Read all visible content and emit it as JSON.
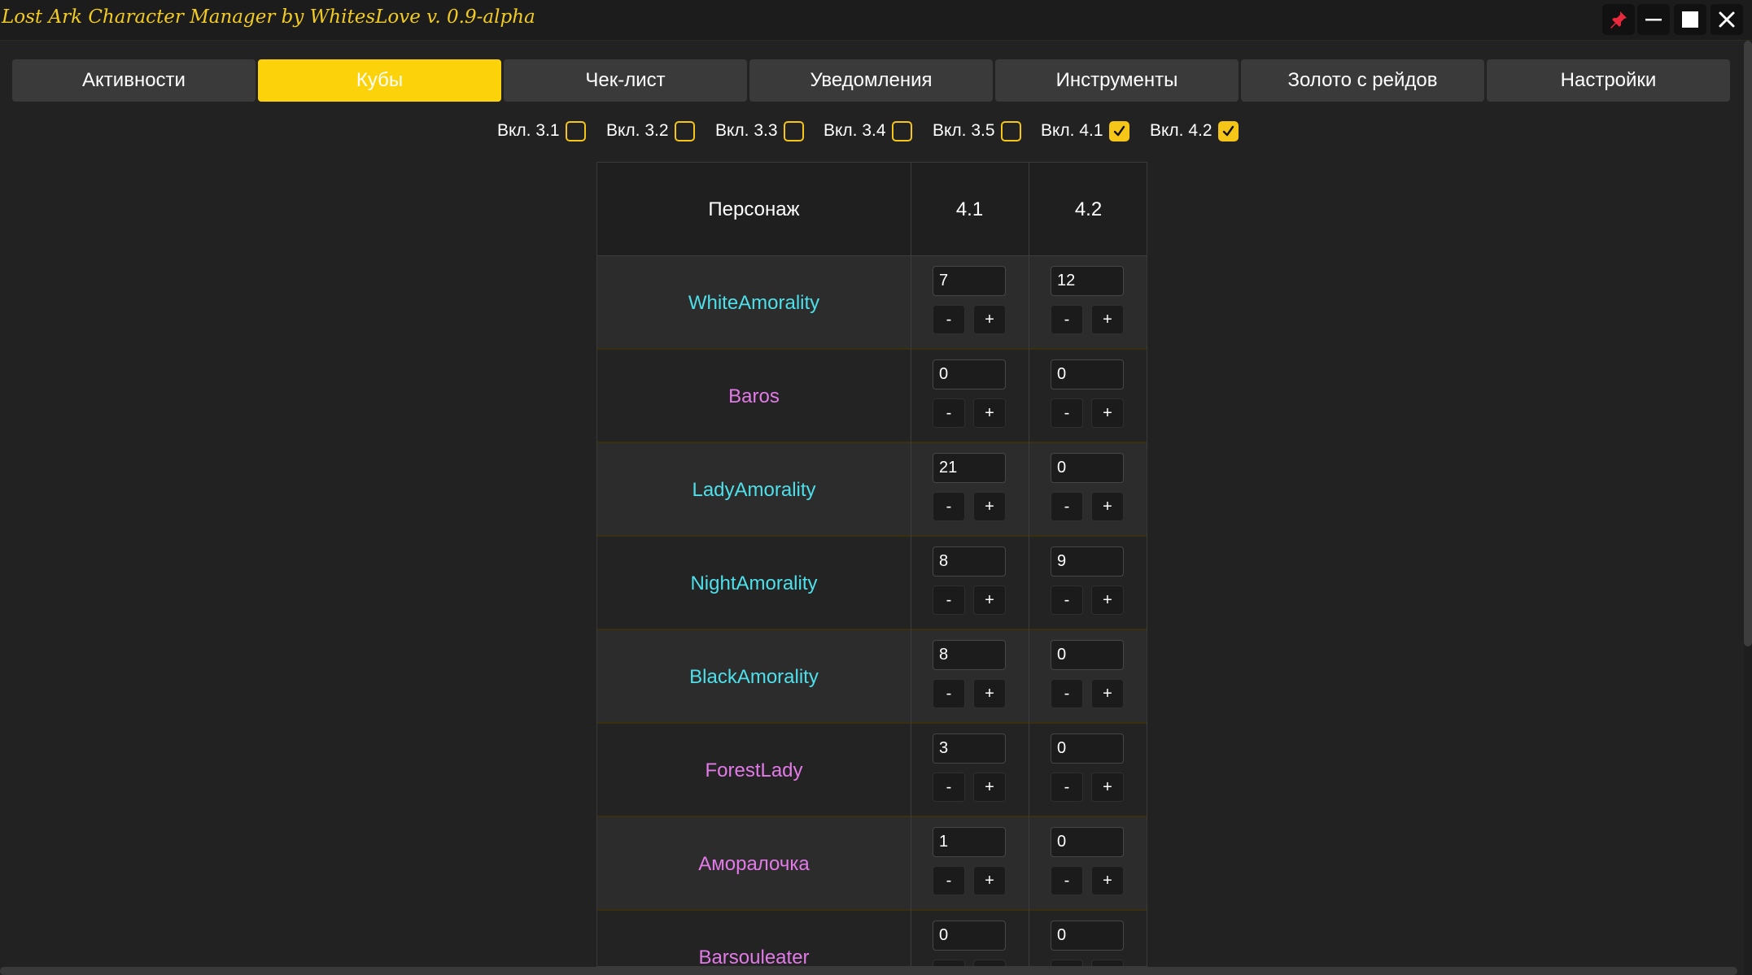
{
  "window": {
    "title": "Lost Ark Character Manager by WhitesLove v. 0.9-alpha",
    "controls": [
      "pin-icon",
      "minimize-icon",
      "maximize-icon",
      "close-icon"
    ],
    "title_color": "#f3cc22"
  },
  "tabs": [
    {
      "label": "Активности",
      "active": false
    },
    {
      "label": "Кубы",
      "active": true
    },
    {
      "label": "Чек-лист",
      "active": false
    },
    {
      "label": "Уведомления",
      "active": false
    },
    {
      "label": "Инструменты",
      "active": false
    },
    {
      "label": "Золото с рейдов",
      "active": false
    },
    {
      "label": "Настройки",
      "active": false
    }
  ],
  "accent_color": "#fcd20a",
  "filters": [
    {
      "label": "Вкл. 3.1",
      "checked": false
    },
    {
      "label": "Вкл. 3.2",
      "checked": false
    },
    {
      "label": "Вкл. 3.3",
      "checked": false
    },
    {
      "label": "Вкл. 3.4",
      "checked": false
    },
    {
      "label": "Вкл. 3.5",
      "checked": false
    },
    {
      "label": "Вкл. 4.1",
      "checked": true
    },
    {
      "label": "Вкл. 4.2",
      "checked": true
    }
  ],
  "table": {
    "headers": [
      "Персонаж",
      "4.1",
      "4.2"
    ],
    "decrement_label": "-",
    "increment_label": "+",
    "rows": [
      {
        "name": "WhiteAmorality",
        "color": "#4ee0ea",
        "values": [
          "7",
          "12"
        ]
      },
      {
        "name": "Baros",
        "color": "#e27ae8",
        "values": [
          "0",
          "0"
        ]
      },
      {
        "name": "LadyAmorality",
        "color": "#4ee0ea",
        "values": [
          "21",
          "0"
        ]
      },
      {
        "name": "NightAmorality",
        "color": "#4ee0ea",
        "values": [
          "8",
          "9"
        ]
      },
      {
        "name": "BlackAmorality",
        "color": "#4ee0ea",
        "values": [
          "8",
          "0"
        ]
      },
      {
        "name": "ForestLady",
        "color": "#e27ae8",
        "values": [
          "3",
          "0"
        ]
      },
      {
        "name": "Аморалочка",
        "color": "#e27ae8",
        "values": [
          "1",
          "0"
        ]
      },
      {
        "name": "Barsouleater",
        "color": "#e27ae8",
        "values": [
          "0",
          "0"
        ]
      }
    ]
  }
}
